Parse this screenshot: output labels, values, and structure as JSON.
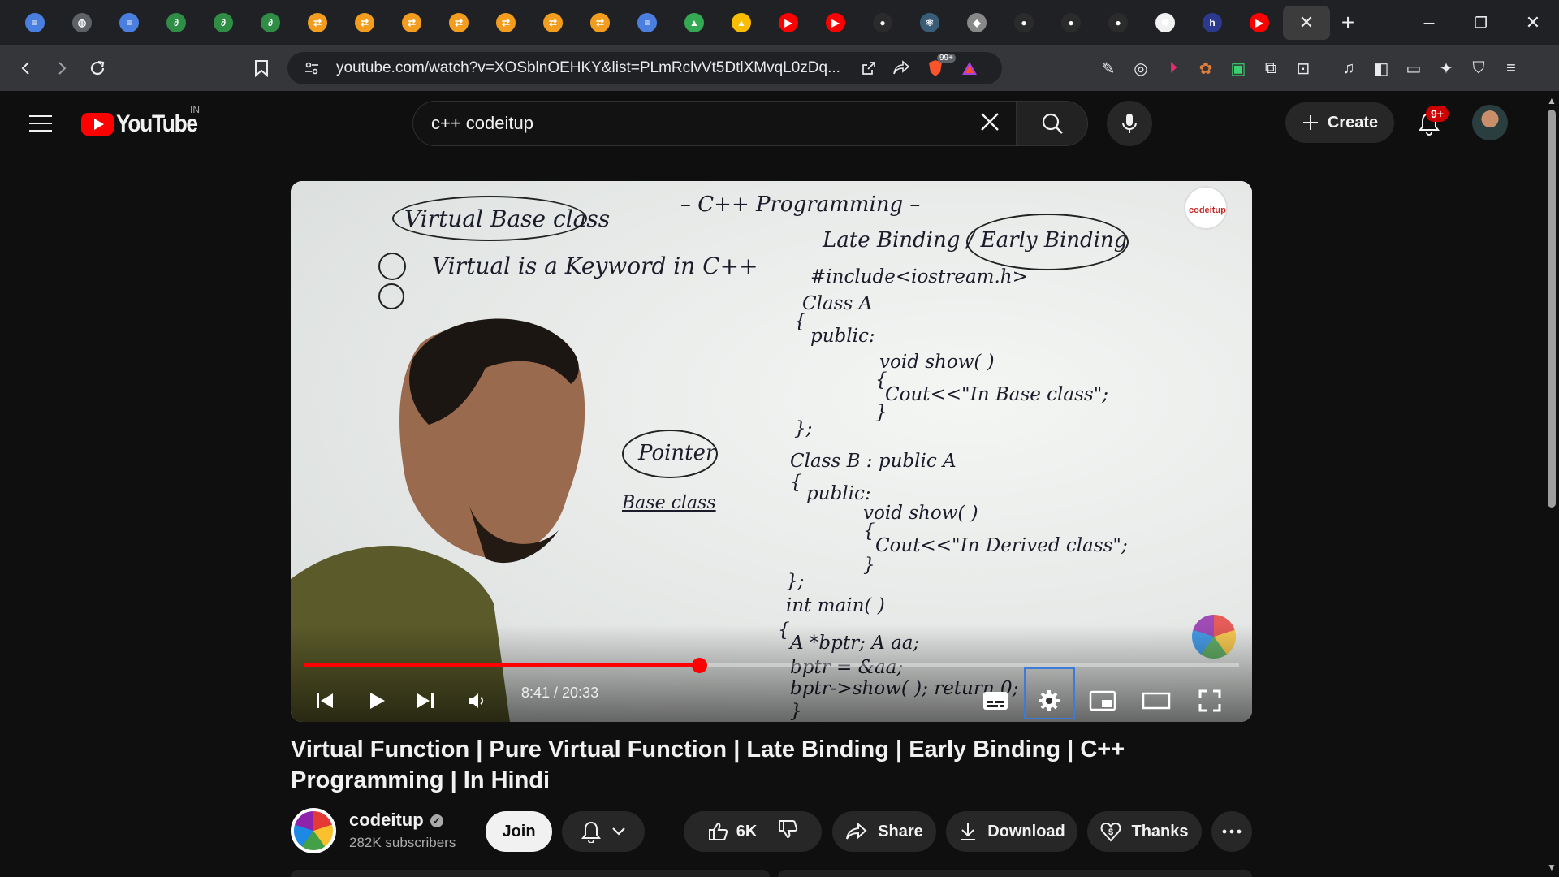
{
  "browser": {
    "tabs": [
      {
        "icon": "document-icon",
        "color": "#4a7fe0",
        "glyph": "≡"
      },
      {
        "icon": "ide-icon",
        "color": "#5f6368",
        "glyph": "◍"
      },
      {
        "icon": "document-icon",
        "color": "#4a7fe0",
        "glyph": "≡"
      },
      {
        "icon": "gfg-icon",
        "color": "#2f8d46",
        "glyph": "∂"
      },
      {
        "icon": "gfg-icon",
        "color": "#2f8d46",
        "glyph": "∂"
      },
      {
        "icon": "gfg-icon",
        "color": "#2f8d46",
        "glyph": "∂"
      },
      {
        "icon": "code-site-icon",
        "color": "#f29d1e",
        "glyph": "⇄"
      },
      {
        "icon": "code-site-icon",
        "color": "#f29d1e",
        "glyph": "⇄"
      },
      {
        "icon": "code-site-icon",
        "color": "#f29d1e",
        "glyph": "⇄"
      },
      {
        "icon": "code-site-icon",
        "color": "#f29d1e",
        "glyph": "⇄"
      },
      {
        "icon": "code-site-icon",
        "color": "#f29d1e",
        "glyph": "⇄"
      },
      {
        "icon": "code-site-icon",
        "color": "#f29d1e",
        "glyph": "⇄"
      },
      {
        "icon": "code-site-icon",
        "color": "#f29d1e",
        "glyph": "⇄"
      },
      {
        "icon": "document-icon",
        "color": "#4a7fe0",
        "glyph": "≡"
      },
      {
        "icon": "drive-icon",
        "color": "#34a853",
        "glyph": "▲"
      },
      {
        "icon": "drive-icon",
        "color": "#fbbc04",
        "glyph": "▲"
      },
      {
        "icon": "youtube-icon",
        "color": "#ff0000",
        "glyph": "▶"
      },
      {
        "icon": "youtube-icon",
        "color": "#ff0000",
        "glyph": "▶"
      },
      {
        "icon": "github-icon",
        "color": "#2b2b2b",
        "glyph": "●"
      },
      {
        "icon": "react-icon",
        "color": "#3a5d77",
        "glyph": "⚛"
      },
      {
        "icon": "shield-icon",
        "color": "#888888",
        "glyph": "◆"
      },
      {
        "icon": "github-icon",
        "color": "#2b2b2b",
        "glyph": "●"
      },
      {
        "icon": "github-icon",
        "color": "#2b2b2b",
        "glyph": "●"
      },
      {
        "icon": "github-icon",
        "color": "#2b2b2b",
        "glyph": "●"
      },
      {
        "icon": "openai-icon",
        "color": "#f1f1f1",
        "glyph": "✺"
      },
      {
        "icon": "hashnode-icon",
        "color": "#2b3a8f",
        "glyph": "h"
      },
      {
        "icon": "youtube-icon",
        "color": "#ff0000",
        "glyph": "▶"
      }
    ],
    "url": "youtube.com/watch?v=XOSblnOEHKY&list=PLmRclvVt5DtlXMvqL0zDq...",
    "brave_badge": "99+"
  },
  "youtube": {
    "logo_text": "YouTube",
    "country": "IN",
    "search_value": "c++ codeitup",
    "create_label": "Create",
    "notification_badge": "9+"
  },
  "player": {
    "time": "8:41 / 20:33",
    "progress_fraction": 0.4225,
    "brand_mark": "codeitup",
    "board": {
      "heading": "– C++ Programming –",
      "line1": "Virtual  Base class",
      "line2": "Virtual is a Keyword in C++",
      "line3": "Late Binding / Early Binding",
      "code": [
        "#include<iostream.h>",
        "Class A",
        "{",
        "public:",
        "void show( )",
        "{",
        "Cout<<\"In Base class\";",
        "}",
        "};",
        "Class B : public A",
        "{",
        "public:",
        "void show( )",
        "{",
        "Cout<<\"In Derived class\";",
        "}",
        "};",
        "int main( )",
        "{",
        "A *bptr; A aa;",
        "bptr = &aa;",
        "bptr->show( );   return 0;",
        "}"
      ],
      "pointer_label": "Pointer",
      "pointer_sub": "Base class"
    }
  },
  "video": {
    "title": "Virtual Function | Pure Virtual Function | Late Binding | Early Binding | C++ Programming | In Hindi",
    "channel": "codeitup",
    "subscribers": "282K subscribers",
    "join_label": "Join",
    "likes": "6K",
    "share_label": "Share",
    "download_label": "Download",
    "thanks_label": "Thanks"
  }
}
